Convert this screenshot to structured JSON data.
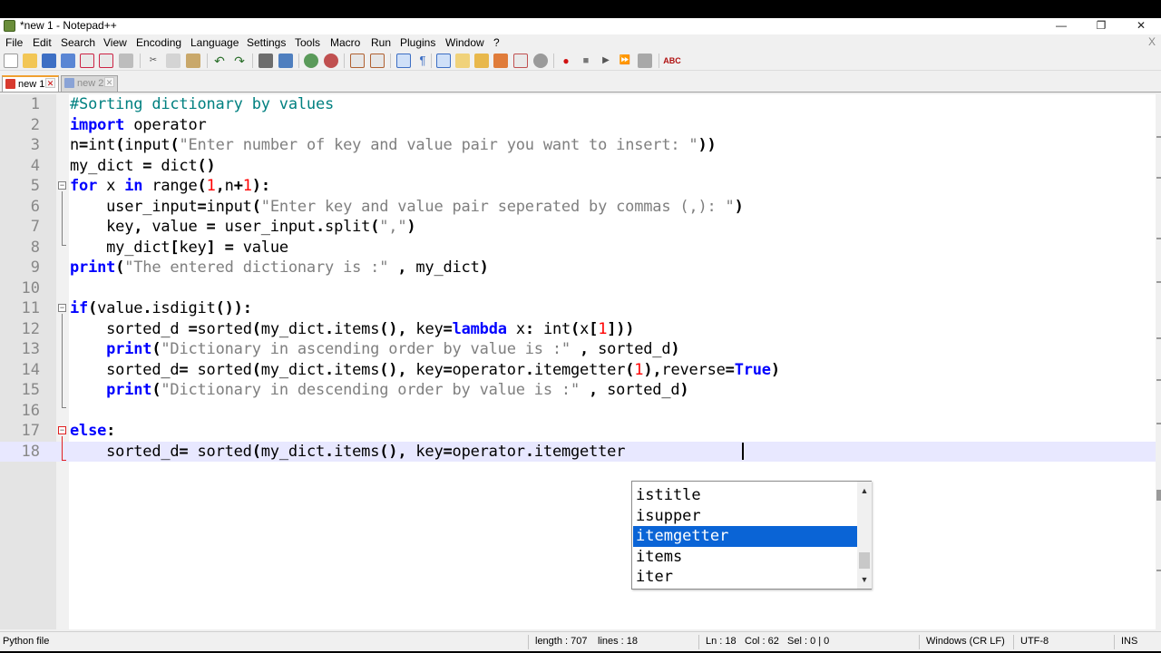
{
  "window": {
    "title": "*new 1 - Notepad++"
  },
  "window_controls": {
    "minimize": "—",
    "maximize": "❐",
    "close": "✕"
  },
  "menu": {
    "items": [
      "File",
      "Edit",
      "Search",
      "View",
      "Encoding",
      "Language",
      "Settings",
      "Tools",
      "Macro",
      "Run",
      "Plugins",
      "Window",
      "?"
    ],
    "close_glyph": "X"
  },
  "toolbar": {
    "buttons": [
      "new-file-icon",
      "open-file-icon",
      "save-icon",
      "save-all-icon",
      "close-icon",
      "close-all-icon",
      "print-icon",
      "cut-icon",
      "copy-icon",
      "paste-icon",
      "undo-icon",
      "redo-icon",
      "find-icon",
      "replace-icon",
      "zoom-in-icon",
      "zoom-out-icon",
      "sync-vertical-icon",
      "sync-horizontal-icon",
      "word-wrap-icon",
      "show-all-chars-icon",
      "indent-guide-icon",
      "user-language-icon",
      "doc-map-icon",
      "function-list-icon",
      "folder-workspace-icon",
      "monitoring-icon",
      "record-macro-icon",
      "stop-record-icon",
      "play-macro-icon",
      "run-macro-multiple-icon",
      "save-macro-icon",
      "spell-check-icon"
    ],
    "spell_check_label": "ABC"
  },
  "tabs": [
    {
      "label": "new 1",
      "active": true
    },
    {
      "label": "new 2",
      "active": false
    }
  ],
  "editor": {
    "language": "Python",
    "current_line": 18,
    "lines": [
      "#Sorting dictionary by values",
      "import operator",
      "n=int(input(\"Enter number of key and value pair you want to insert: \"))",
      "my_dict = dict()",
      "for x in range(1,n+1):",
      "    user_input=input(\"Enter key and value pair seperated by commas (,): \")",
      "    key, value = user_input.split(\",\")",
      "    my_dict[key] = value",
      "print(\"The entered dictionary is :\" , my_dict)",
      "",
      "if(value.isdigit()):",
      "    sorted_d =sorted(my_dict.items(), key=lambda x: int(x[1]))",
      "    print(\"Dictionary in ascending order by value is :\" , sorted_d)",
      "    sorted_d= sorted(my_dict.items(), key=operator.itemgetter(1),reverse=True)",
      "    print(\"Dictionary in descending order by value is :\" , sorted_d)",
      "",
      "else:",
      "    sorted_d= sorted(my_dict.items(), key=operator.itemgetter"
    ]
  },
  "autocomplete": {
    "items": [
      "istitle",
      "isupper",
      "itemgetter",
      "items",
      "iter"
    ],
    "selected": "itemgetter",
    "scroll_up": "▲",
    "scroll_down": "▼"
  },
  "status": {
    "file_type": "Python file",
    "length": "length : 707",
    "lines": "lines : 18",
    "ln": "Ln : 18",
    "col": "Col : 62",
    "sel": "Sel : 0 | 0",
    "eol": "Windows (CR LF)",
    "encoding": "UTF-8",
    "mode": "INS"
  }
}
